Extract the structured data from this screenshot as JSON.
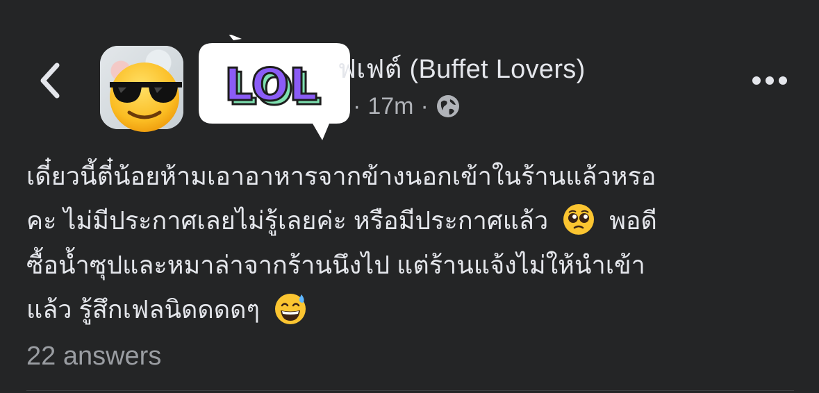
{
  "header": {
    "back_icon": "chevron-left-icon",
    "group_name_visible": "ฟเฟต์ (Buffet Lovers)",
    "meta_separator": "·",
    "time": "17m",
    "privacy_icon": "globe-icon",
    "more_icon": "ellipsis-horizontal-icon",
    "avatar_overlay_icon": "sunglasses-emoji-icon",
    "sticker_text": "LOL"
  },
  "post": {
    "lines": [
      "เดี๋ยวนี้ตี๋น้อยห้ามเอาอาหารจากข้างนอกเข้าในร้านแล้วหรอ",
      "คะ ไม่มีประกาศเลยไม่รู้เลยค่ะ หรือมีประกาศแล้ว",
      "พอดี",
      "ซื้อน้ำซุปและหมาล่าจากร้านนึงไป แต่ร้านแจ้งไม่ให้นำเข้า",
      "แล้ว รู้สึกเฟลนิดดดดๆ"
    ],
    "emoji_1": "pleading-face-emoji",
    "emoji_2": "grinning-sweat-emoji"
  },
  "footer": {
    "answers": "22 answers"
  },
  "colors": {
    "background": "#242526",
    "primary_text": "#e4e6eb",
    "secondary_text": "#b0b3b8",
    "sticker_purple": "#8b5cf6",
    "sticker_green": "#7ee0b0"
  }
}
